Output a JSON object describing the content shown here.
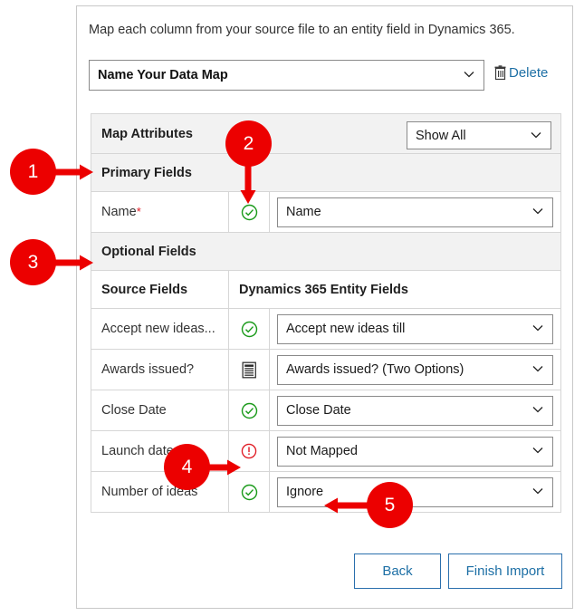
{
  "intro": {
    "text": "Map each column from your source file to an entity field in Dynamics 365."
  },
  "datamap": {
    "selected": "Name Your Data Map",
    "placeholder": "Name Your Data Map",
    "delete_label": "Delete",
    "delete_icon": "trash-icon",
    "chevron_icon": "chevron-down-icon"
  },
  "map_attributes": {
    "label": "Map Attributes",
    "filter_selected": "Show All",
    "filter_options": [
      "Show All"
    ]
  },
  "sections": {
    "primary": "Primary Fields",
    "optional": "Optional Fields"
  },
  "columns": {
    "source": "Source Fields",
    "target": "Dynamics 365 Entity Fields"
  },
  "primary_rows": [
    {
      "source": "Name",
      "required": true,
      "required_marker": "*",
      "status": "ok",
      "status_icon": "check-circle-icon",
      "target": "Name"
    }
  ],
  "optional_rows": [
    {
      "source": "Accept new ideas...",
      "status": "ok",
      "status_icon": "check-circle-icon",
      "target": "Accept new ideas till"
    },
    {
      "source": "Awards issued?",
      "status": "doc",
      "status_icon": "option-set-icon",
      "target": "Awards issued? (Two Options)"
    },
    {
      "source": "Close Date",
      "status": "ok",
      "status_icon": "check-circle-icon",
      "target": "Close Date"
    },
    {
      "source": "Launch date",
      "status": "warn",
      "status_icon": "exclamation-circle-icon",
      "target": "Not Mapped"
    },
    {
      "source": "Number of ideas",
      "status": "ok",
      "status_icon": "check-circle-icon",
      "target": "Ignore"
    }
  ],
  "footer": {
    "back_label": "Back",
    "finish_label": "Finish Import"
  },
  "callouts": [
    {
      "number": "1",
      "points_to": "Primary Fields section header"
    },
    {
      "number": "2",
      "points_to": "status icon on Name row"
    },
    {
      "number": "3",
      "points_to": "Optional Fields section header"
    },
    {
      "number": "4",
      "points_to": "warning icon on Launch date row"
    },
    {
      "number": "5",
      "points_to": "Ignore value on Number of ideas row"
    }
  ],
  "colors": {
    "callout_red": "#ec0000",
    "link_blue": "#1d6fa5",
    "status_ok_green": "#1a9a1a",
    "status_warn_red": "#e01b24",
    "header_grey": "#f2f2f2"
  }
}
